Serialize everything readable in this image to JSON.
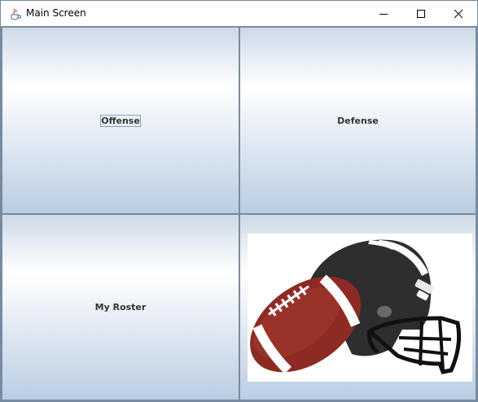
{
  "window": {
    "title": "Main Screen",
    "app_icon": "java-cup-icon",
    "controls": {
      "minimize": "minimize-icon",
      "maximize": "maximize-icon",
      "close": "close-icon"
    }
  },
  "buttons": {
    "offense": "Offense",
    "defense": "Defense",
    "roster": "My Roster"
  },
  "image": {
    "subject": "football-and-helmet-illustration"
  },
  "colors": {
    "button_gradient_top": "#cdd9e6",
    "button_gradient_mid": "#ffffff",
    "button_gradient_bottom": "#b9cde3",
    "label_text": "#333333",
    "helmet": "#2a2a2a",
    "football": "#8e2a24"
  }
}
